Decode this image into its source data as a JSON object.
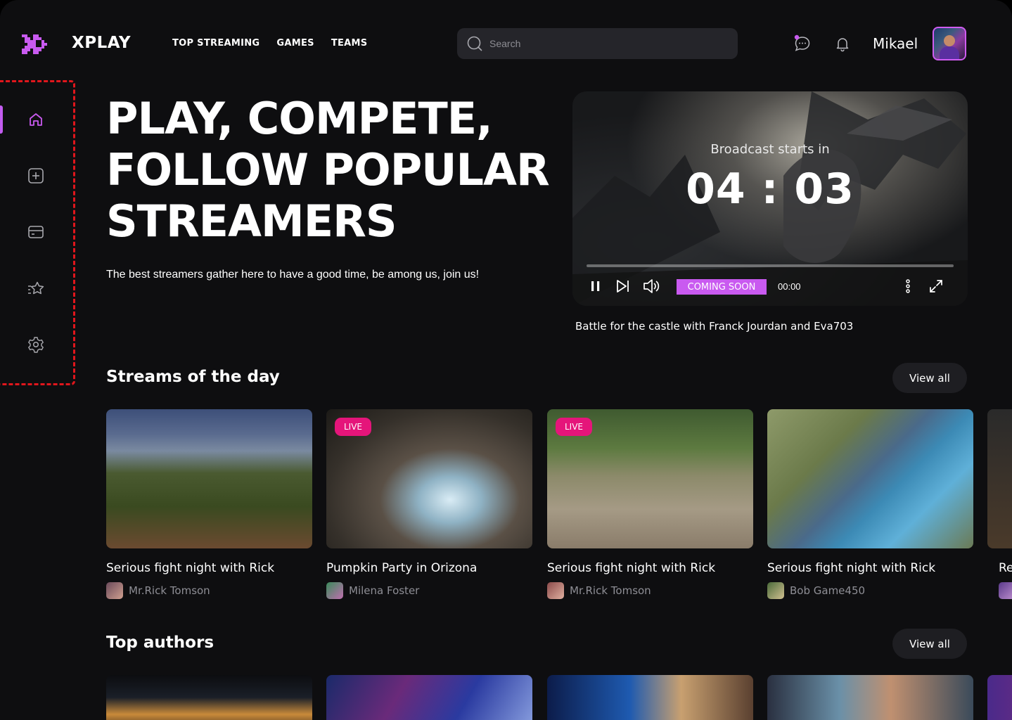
{
  "brand": {
    "name": "XPLAY",
    "accent": "#c95af0"
  },
  "nav": {
    "items": [
      "TOP STREAMING",
      "GAMES",
      "TEAMS"
    ]
  },
  "search": {
    "placeholder": "Search"
  },
  "user": {
    "name": "Mikael"
  },
  "sidebar": {
    "items": [
      {
        "icon": "home-icon",
        "active": true
      },
      {
        "icon": "add-icon",
        "active": false
      },
      {
        "icon": "card-icon",
        "active": false
      },
      {
        "icon": "favorites-icon",
        "active": false
      },
      {
        "icon": "settings-icon",
        "active": false
      }
    ]
  },
  "hero": {
    "title": "PLAY, COMPETE,\nFOLLOW POPULAR\nSTREAMERS",
    "subtitle": "The best streamers gather here to have a good time, be among us, join us!"
  },
  "player": {
    "broadcast_label": "Broadcast starts in",
    "countdown": "04 : 03",
    "status": "COMING SOON",
    "time": "00:00",
    "progress": 0,
    "caption": "Battle for the castle with Franck Jourdan and Eva703"
  },
  "streams": {
    "title": "Streams of the day",
    "view_all": "View all",
    "items": [
      {
        "title": "Serious fight night with Rick",
        "author": "Mr.Rick Tomson",
        "live": false
      },
      {
        "title": "Pumpkin Party in Orizona",
        "author": "Milena Foster",
        "live": true,
        "live_label": "LIVE"
      },
      {
        "title": "Serious fight night with Rick",
        "author": "Mr.Rick Tomson",
        "live": true,
        "live_label": "LIVE"
      },
      {
        "title": "Serious fight night with Rick",
        "author": "Bob Game450",
        "live": false
      },
      {
        "title": "Re",
        "author": "",
        "live": false
      }
    ]
  },
  "authors": {
    "title": "Top authors",
    "view_all": "View all"
  }
}
